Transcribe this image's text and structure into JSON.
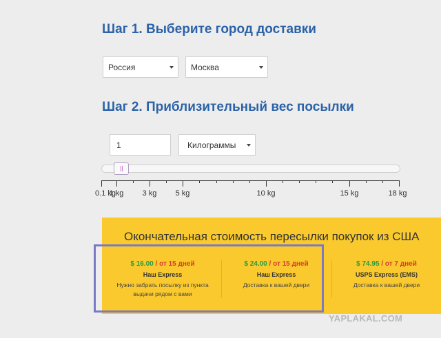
{
  "step1": {
    "title": "Шаг 1. Выберите город доставки",
    "country": "Россия",
    "city": "Москва"
  },
  "step2": {
    "title": "Шаг 2. Приблизительный вес посылки",
    "weight_value": "1",
    "unit": "Килограммы",
    "slider_value_kg": 1.3,
    "scale": {
      "min": 0.1,
      "max": 18,
      "major_ticks": [
        {
          "value": 0.1,
          "label": "0.1 kg"
        },
        {
          "value": 1,
          "label": "1 kg"
        },
        {
          "value": 3,
          "label": "3 kg"
        },
        {
          "value": 5,
          "label": "5 kg"
        },
        {
          "value": 10,
          "label": "10 kg"
        },
        {
          "value": 15,
          "label": "15 kg"
        },
        {
          "value": 18,
          "label": "18 kg"
        }
      ]
    }
  },
  "result": {
    "heading": "Окончательная стоимость пересылки покупок из США",
    "options": [
      {
        "amount": "$ 16.00",
        "days": "/ от 15 дней",
        "name": "Наш Express",
        "description": "Нужно забрать посылку из пункта выдачи рядом с вами"
      },
      {
        "amount": "$ 24.00",
        "days": "/ от 15 дней",
        "name": "Наш Express",
        "description": "Доставка к вашей двери"
      },
      {
        "amount": "$ 74.95",
        "days": "/ от 7 дней",
        "name": "USPS Express (EMS)",
        "description": "Доставка к вашей двери"
      }
    ]
  },
  "watermark": "YAPLAKAL.COM",
  "colors": {
    "title": "#2b62a8",
    "panel": "#f9c92d",
    "price": "#2e9a3a",
    "days": "#d73b2f",
    "highlight": "#7a7ac4"
  }
}
